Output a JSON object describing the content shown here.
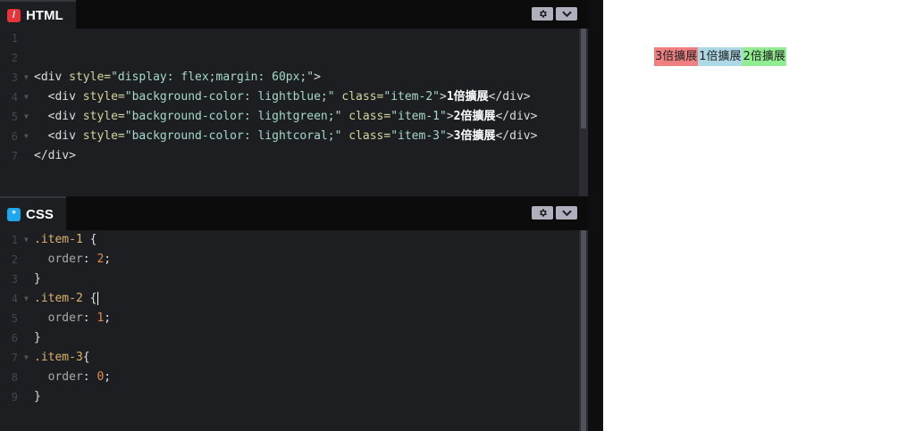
{
  "html_pane": {
    "tab_label": "HTML",
    "badge_glyph": "/",
    "lines": [
      {
        "n": "1",
        "fold": false,
        "parts": []
      },
      {
        "n": "2",
        "fold": false,
        "parts": []
      },
      {
        "n": "3",
        "fold": true,
        "parts": [
          {
            "t": "<div ",
            "c": "t-tag"
          },
          {
            "t": "style=",
            "c": "t-attr"
          },
          {
            "t": "\"display: flex;margin: 60px;\"",
            "c": "t-str"
          },
          {
            "t": ">",
            "c": "t-tag"
          }
        ]
      },
      {
        "n": "4",
        "fold": true,
        "parts": [
          {
            "t": "  <div ",
            "c": "t-tag"
          },
          {
            "t": "style=",
            "c": "t-attr"
          },
          {
            "t": "\"background-color: lightblue;\"",
            "c": "t-str"
          },
          {
            "t": " class=",
            "c": "t-attr"
          },
          {
            "t": "\"item-2\"",
            "c": "t-str"
          },
          {
            "t": ">",
            "c": "t-tag"
          },
          {
            "t": "1倍擴展",
            "c": "t-txt"
          },
          {
            "t": "</div>",
            "c": "t-tag"
          }
        ]
      },
      {
        "n": "5",
        "fold": true,
        "parts": [
          {
            "t": "  <div ",
            "c": "t-tag"
          },
          {
            "t": "style=",
            "c": "t-attr"
          },
          {
            "t": "\"background-color: lightgreen;\"",
            "c": "t-str"
          },
          {
            "t": " class=",
            "c": "t-attr"
          },
          {
            "t": "\"item-1\"",
            "c": "t-str"
          },
          {
            "t": ">",
            "c": "t-tag"
          },
          {
            "t": "2倍擴展",
            "c": "t-txt"
          },
          {
            "t": "</div>",
            "c": "t-tag"
          }
        ]
      },
      {
        "n": "6",
        "fold": true,
        "parts": [
          {
            "t": "  <div ",
            "c": "t-tag"
          },
          {
            "t": "style=",
            "c": "t-attr"
          },
          {
            "t": "\"background-color: lightcoral;\"",
            "c": "t-str"
          },
          {
            "t": " class=",
            "c": "t-attr"
          },
          {
            "t": "\"item-3\"",
            "c": "t-str"
          },
          {
            "t": ">",
            "c": "t-tag"
          },
          {
            "t": "3倍擴展",
            "c": "t-txt"
          },
          {
            "t": "</div>",
            "c": "t-tag"
          }
        ]
      },
      {
        "n": "7",
        "fold": false,
        "parts": [
          {
            "t": "</div>",
            "c": "t-tag"
          }
        ]
      }
    ]
  },
  "css_pane": {
    "tab_label": "CSS",
    "badge_glyph": "*",
    "lines": [
      {
        "n": "1",
        "fold": true,
        "parts": [
          {
            "t": ".item-1 ",
            "c": "t-sel"
          },
          {
            "t": "{",
            "c": "t-pun"
          }
        ]
      },
      {
        "n": "2",
        "fold": false,
        "parts": [
          {
            "t": "  order",
            "c": "t-prop"
          },
          {
            "t": ": ",
            "c": "t-pun"
          },
          {
            "t": "2",
            "c": "t-num"
          },
          {
            "t": ";",
            "c": "t-pun"
          }
        ]
      },
      {
        "n": "3",
        "fold": false,
        "parts": [
          {
            "t": "}",
            "c": "t-pun"
          }
        ]
      },
      {
        "n": "4",
        "fold": true,
        "parts": [
          {
            "t": ".item-2 ",
            "c": "t-sel"
          },
          {
            "t": "{",
            "c": "t-pun"
          }
        ],
        "cursor": true
      },
      {
        "n": "5",
        "fold": false,
        "parts": [
          {
            "t": "  order",
            "c": "t-prop"
          },
          {
            "t": ": ",
            "c": "t-pun"
          },
          {
            "t": "1",
            "c": "t-num"
          },
          {
            "t": ";",
            "c": "t-pun"
          }
        ]
      },
      {
        "n": "6",
        "fold": false,
        "parts": [
          {
            "t": "}",
            "c": "t-pun"
          }
        ]
      },
      {
        "n": "7",
        "fold": true,
        "parts": [
          {
            "t": ".item-3",
            "c": "t-sel"
          },
          {
            "t": "{",
            "c": "t-pun"
          }
        ]
      },
      {
        "n": "8",
        "fold": false,
        "parts": [
          {
            "t": "  order",
            "c": "t-prop"
          },
          {
            "t": ": ",
            "c": "t-pun"
          },
          {
            "t": "0",
            "c": "t-num"
          },
          {
            "t": ";",
            "c": "t-pun"
          }
        ]
      },
      {
        "n": "9",
        "fold": false,
        "parts": [
          {
            "t": "}",
            "c": "t-pun"
          }
        ]
      }
    ]
  },
  "preview": {
    "items": [
      {
        "label": "3倍擴展",
        "color": "#f08080"
      },
      {
        "label": "1倍擴展",
        "color": "#add8e6"
      },
      {
        "label": "2倍擴展",
        "color": "#90ee90"
      }
    ]
  },
  "colors": {
    "editor_bg": "#1d1e22",
    "html_badge": "#e5343c",
    "css_badge": "#1ea7ee"
  },
  "icons": {
    "settings": "gear-icon",
    "collapse": "chevron-down-icon"
  }
}
